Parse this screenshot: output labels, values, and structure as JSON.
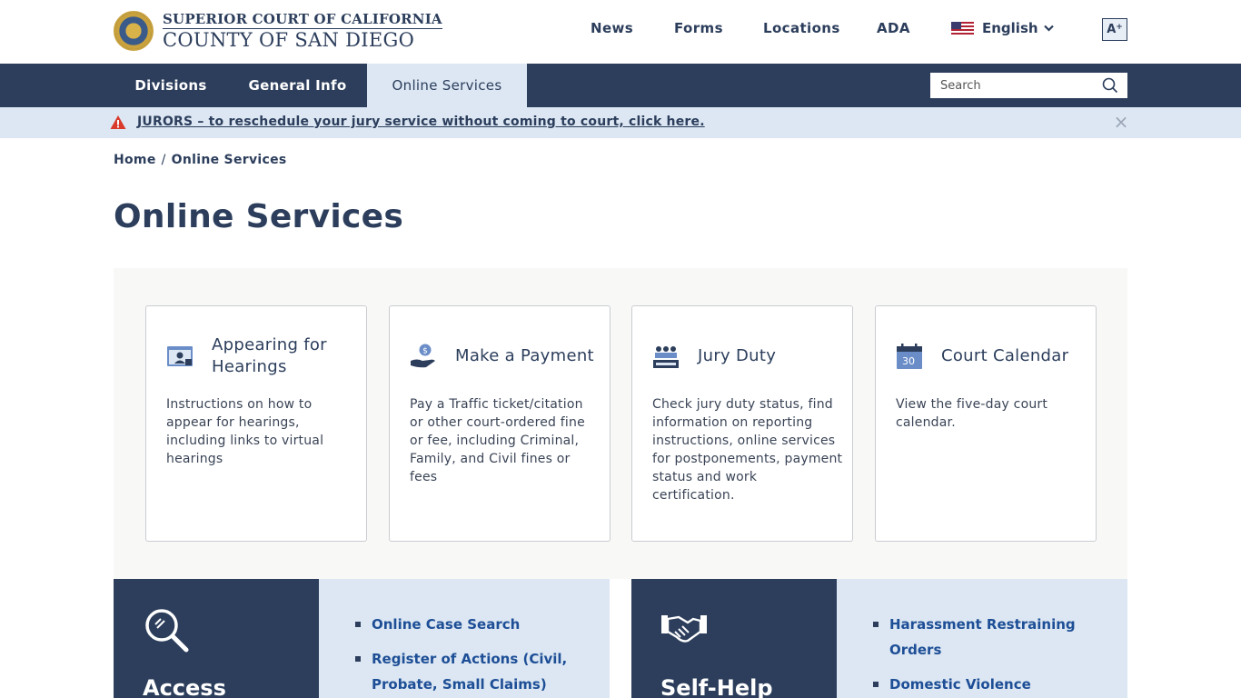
{
  "header": {
    "logo_line1": "SUPERIOR COURT OF CALIFORNIA",
    "logo_line2": "COUNTY OF SAN DIEGO",
    "nav": [
      "News",
      "Forms",
      "Locations",
      "ADA"
    ],
    "language": "English",
    "font_size_label": "A",
    "font_size_sup": "+"
  },
  "mainnav": {
    "items": [
      "Divisions",
      "General Info",
      "Online Services"
    ],
    "active": "Online Services",
    "search_placeholder": "Search"
  },
  "alert": {
    "text": "JURORS – to reschedule your jury service without coming to court, click here.",
    "close_symbol": "×"
  },
  "breadcrumb": {
    "home": "Home",
    "separator": "/",
    "current": "Online Services"
  },
  "page_title": "Online Services",
  "cards": [
    {
      "icon": "video-hearing-icon",
      "title": "Appearing for Hearings",
      "desc": "Instructions on how to appear for hearings, including links to virtual hearings"
    },
    {
      "icon": "payment-hand-icon",
      "title": "Make a Payment",
      "desc": "Pay a Traffic ticket/citation or other court-ordered fine or fee, including Criminal, Family, and Civil fines or fees"
    },
    {
      "icon": "jury-icon",
      "title": "Jury Duty",
      "desc": "Check jury duty status, find information on reporting instructions, online services for postponements, payment status and work certification."
    },
    {
      "icon": "calendar-icon",
      "title": "Court Calendar",
      "desc": "View the five-day court calendar.",
      "calendar_day": "30"
    }
  ],
  "features": [
    {
      "title": "Access",
      "icon": "magnifier-icon",
      "links": [
        "Online Case Search",
        "Register of Actions (Civil, Probate, Small Claims)"
      ]
    },
    {
      "title": "Self-Help",
      "icon": "handshake-icon",
      "links": [
        "Harassment Restraining Orders",
        "Domestic Violence"
      ]
    }
  ],
  "colors": {
    "navy": "#2c3e5c",
    "light_blue": "#dce7f3",
    "link_blue": "#1d4e96",
    "alert_red": "#d93a2b",
    "panel_gray": "#f8f8f6"
  }
}
